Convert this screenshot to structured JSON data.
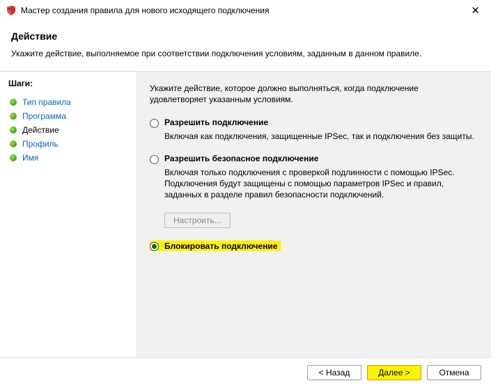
{
  "window": {
    "title": "Мастер создания правила для нового исходящего подключения"
  },
  "header": {
    "title": "Действие",
    "subtitle": "Укажите действие, выполняемое при соответствии подключения условиям, заданным в данном правиле."
  },
  "sidebar": {
    "title": "Шаги:",
    "steps": [
      {
        "label": "Тип правила",
        "state": "link"
      },
      {
        "label": "Программа",
        "state": "link"
      },
      {
        "label": "Действие",
        "state": "current"
      },
      {
        "label": "Профиль",
        "state": "link"
      },
      {
        "label": "Имя",
        "state": "link"
      }
    ]
  },
  "content": {
    "intro": "Укажите действие, которое должно выполняться, когда подключение удовлетворяет указанным условиям.",
    "options": [
      {
        "id": "allow",
        "label": "Разрешить подключение",
        "checked": false,
        "highlighted": false,
        "desc": "Включая как подключения, защищенные IPSec, так и подключения без защиты."
      },
      {
        "id": "allow-secure",
        "label": "Разрешить безопасное подключение",
        "checked": false,
        "highlighted": false,
        "desc": "Включая только подключения с проверкой подлинности с помощью IPSec. Подключения будут защищены с помощью параметров IPSec и правил, заданных в разделе правил безопасности подключений."
      },
      {
        "id": "block",
        "label": "Блокировать подключение",
        "checked": true,
        "highlighted": true,
        "desc": ""
      }
    ],
    "customize_label": "Настроить..."
  },
  "footer": {
    "back": "< Назад",
    "next": "Далее >",
    "cancel": "Отмена"
  }
}
